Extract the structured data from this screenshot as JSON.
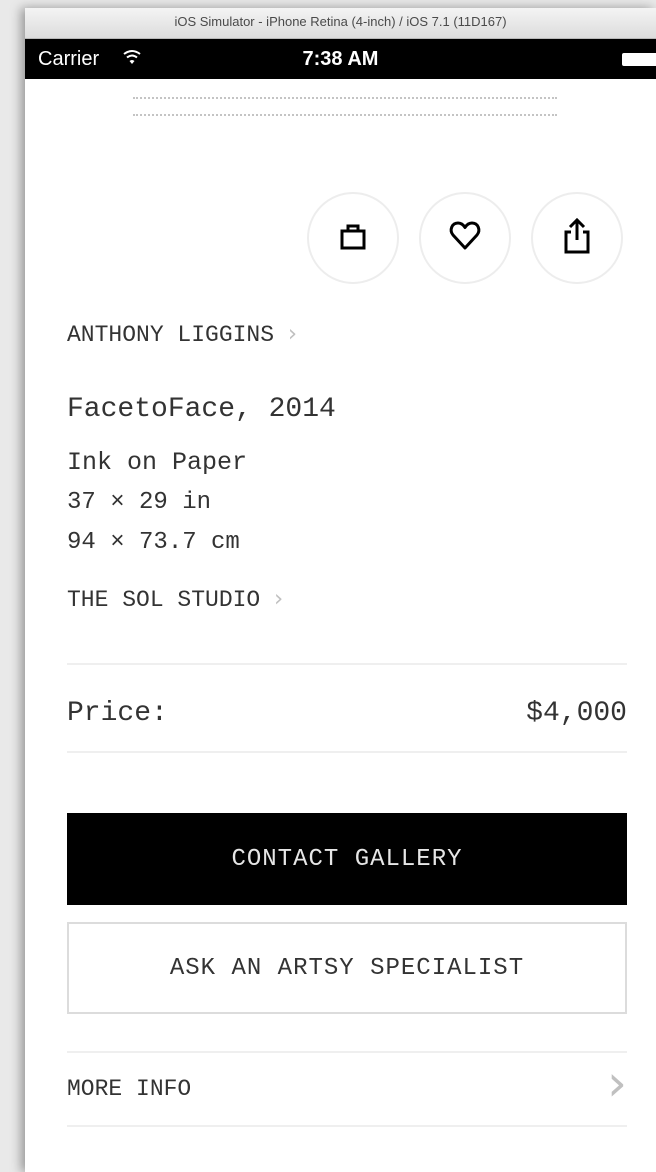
{
  "simulator": {
    "title": "iOS Simulator - iPhone Retina (4-inch) / iOS 7.1 (11D167)"
  },
  "status_bar": {
    "carrier": "Carrier",
    "time": "7:38 AM"
  },
  "actions": {
    "icons": [
      "bag-icon",
      "heart-icon",
      "share-icon"
    ]
  },
  "artwork": {
    "artist": "ANTHONY LIGGINS",
    "title": "FacetoFace, 2014",
    "medium": "Ink on Paper",
    "dimensions_in": "37 × 29 in",
    "dimensions_cm": "94 × 73.7 cm",
    "partner": "THE SOL STUDIO"
  },
  "price": {
    "label": "Price:",
    "value": "$4,000"
  },
  "buttons": {
    "contact": "CONTACT GALLERY",
    "specialist": "ASK AN ARTSY SPECIALIST"
  },
  "more_info": {
    "label": "MORE INFO"
  },
  "colors": {
    "primary_button": "#000000",
    "background": "#ffffff",
    "chevron": "#c0c0c0"
  }
}
